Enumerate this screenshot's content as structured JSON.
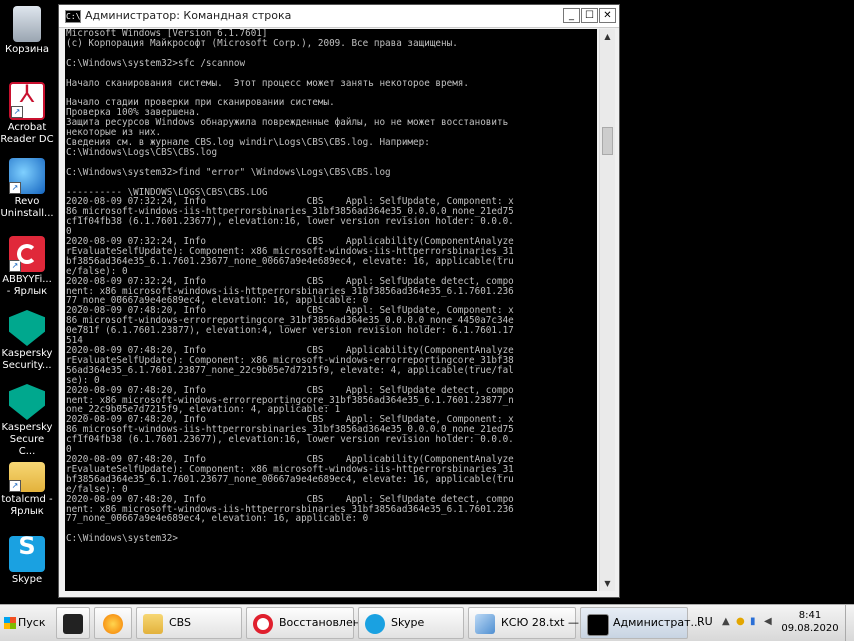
{
  "desktop": {
    "icons": [
      {
        "label": "Корзина"
      },
      {
        "label": "Acrobat Reader DC"
      },
      {
        "label": "Revo Uninstall..."
      },
      {
        "label": "ABBYYFi... - Ярлык"
      },
      {
        "label": "Kaspersky Security..."
      },
      {
        "label": "Kaspersky Secure C..."
      },
      {
        "label": "totalcmd - Ярлык"
      },
      {
        "label": "Skype"
      }
    ]
  },
  "window": {
    "title": "Администратор: Командная строка",
    "icon_text": "C:\\",
    "minimize": "_",
    "maximize": "☐",
    "close": "✕",
    "console_lines": [
      "Microsoft Windows [Version 6.1.7601]",
      "(c) Корпорация Майкрософт (Microsoft Corp.), 2009. Все права защищены.",
      "",
      "C:\\Windows\\system32>sfc /scannow",
      "",
      "Начало сканирования системы.  Этот процесс может занять некоторое время.",
      "",
      "Начало стадии проверки при сканировании системы.",
      "Проверка 100% завершена.",
      "Защита ресурсов Windows обнаружила поврежденные файлы, но не может восстановить",
      "некоторые из них.",
      "Сведения см. в журнале CBS.log windir\\Logs\\CBS\\CBS.log. Например:",
      "C:\\Windows\\Logs\\CBS\\CBS.log",
      "",
      "C:\\Windows\\system32>find \"error\" \\Windows\\Logs\\CBS\\CBS.log",
      "",
      "---------- \\WINDOWS\\LOGS\\CBS\\CBS.LOG",
      "2020-08-09 07:32:24, Info                  CBS    Appl: SelfUpdate, Component: x",
      "86_microsoft-windows-iis-httperrorsbinaries_31bf3856ad364e35_0.0.0.0_none_21ed75",
      "cf1f04fb38 (6.1.7601.23677), elevation:16, lower version revision holder: 0.0.0.",
      "0",
      "2020-08-09 07:32:24, Info                  CBS    Applicability(ComponentAnalyze",
      "rEvaluateSelfUpdate): Component: x86_microsoft-windows-iis-httperrorsbinaries_31",
      "bf3856ad364e35_6.1.7601.23677_none_00667a9e4e689ec4, elevate: 16, applicable(tru",
      "e/false): 0",
      "2020-08-09 07:32:24, Info                  CBS    Appl: SelfUpdate detect, compo",
      "nent: x86_microsoft-windows-iis-httperrorsbinaries_31bf3856ad364e35_6.1.7601.236",
      "77_none_00667a9e4e689ec4, elevation: 16, applicable: 0",
      "2020-08-09 07:48:20, Info                  CBS    Appl: SelfUpdate, Component: x",
      "86_microsoft-windows-errorreportingcore_31bf3856ad364e35_0.0.0.0_none_4450a7c34e",
      "0e781f (6.1.7601.23877), elevation:4, lower version revision holder: 6.1.7601.17",
      "514",
      "2020-08-09 07:48:20, Info                  CBS    Applicability(ComponentAnalyze",
      "rEvaluateSelfUpdate): Component: x86_microsoft-windows-errorreportingcore_31bf38",
      "56ad364e35_6.1.7601.23877_none_22c9b05e7d7215f9, elevate: 4, applicable(true/fal",
      "se): 0",
      "2020-08-09 07:48:20, Info                  CBS    Appl: SelfUpdate detect, compo",
      "nent: x86_microsoft-windows-errorreportingcore_31bf3856ad364e35_6.1.7601.23877_n",
      "one_22c9b05e7d7215f9, elevation: 4, applicable: 1",
      "2020-08-09 07:48:20, Info                  CBS    Appl: SelfUpdate, Component: x",
      "86_microsoft-windows-iis-httperrorsbinaries_31bf3856ad364e35_0.0.0.0_none_21ed75",
      "cf1f04fb38 (6.1.7601.23677), elevation:16, lower version revision holder: 0.0.0.",
      "0",
      "2020-08-09 07:48:20, Info                  CBS    Applicability(ComponentAnalyze",
      "rEvaluateSelfUpdate): Component: x86_microsoft-windows-iis-httperrorsbinaries_31",
      "bf3856ad364e35_6.1.7601.23677_none_00667a9e4e689ec4, elevate: 16, applicable(tru",
      "e/false): 0",
      "2020-08-09 07:48:20, Info                  CBS    Appl: SelfUpdate detect, compo",
      "nent: x86_microsoft-windows-iis-httperrorsbinaries_31bf3856ad364e35_6.1.7601.236",
      "77_none_00667a9e4e689ec4, elevation: 16, applicable: 0",
      "",
      "C:\\Windows\\system32>"
    ]
  },
  "taskbar": {
    "start_label": "Пуск",
    "buttons": [
      {
        "label": "CBS"
      },
      {
        "label": "Восстановлен..."
      },
      {
        "label": "Skype"
      },
      {
        "label": "КСЮ 28.txt —..."
      },
      {
        "label": "Администрат..."
      }
    ],
    "language": "RU",
    "time": "8:41",
    "date": "09.08.2020"
  }
}
